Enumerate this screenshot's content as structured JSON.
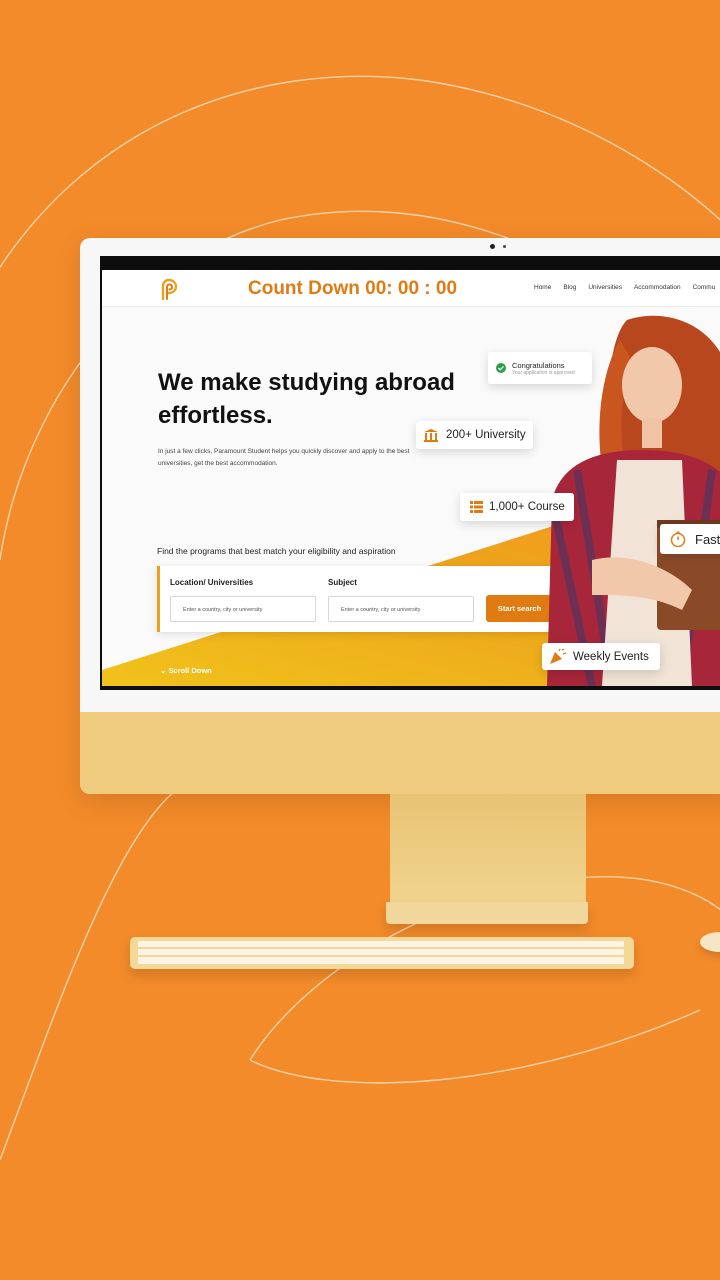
{
  "colors": {
    "background": "#F38B2A",
    "accent": "#E07B12",
    "monitor_chin": "#EFCB7F"
  },
  "site": {
    "countdown": "Count Down 00: 00 : 00",
    "nav": [
      "Home",
      "Blog",
      "Universities",
      "Accommodation",
      "Commu"
    ],
    "hero": {
      "title": "We make studying abroad effortless.",
      "subtitle": "In just a few clicks, Paramount Student helps you quickly discover and apply to the best universities, get the best accommodation."
    },
    "search": {
      "intro": "Find the programs that best match your eligibility and aspiration",
      "location_label": "Location/ Universities",
      "location_placeholder": "Enter a country, city or university",
      "subject_label": "Subject",
      "subject_placeholder": "Enter a country, city or university",
      "button": "Start search"
    },
    "scroll_down": "Scroll Down",
    "badges": {
      "congrats_title": "Congratulations",
      "congrats_sub": "Your application is approved",
      "universities": "200+ University",
      "courses": "1,000+ Course",
      "fast": "Fast",
      "events": "Weekly Events"
    }
  },
  "icons": [
    "logo-icon",
    "check-circle-icon",
    "university-icon",
    "list-icon",
    "stopwatch-icon",
    "party-popper-icon",
    "chevron-down-icon"
  ]
}
